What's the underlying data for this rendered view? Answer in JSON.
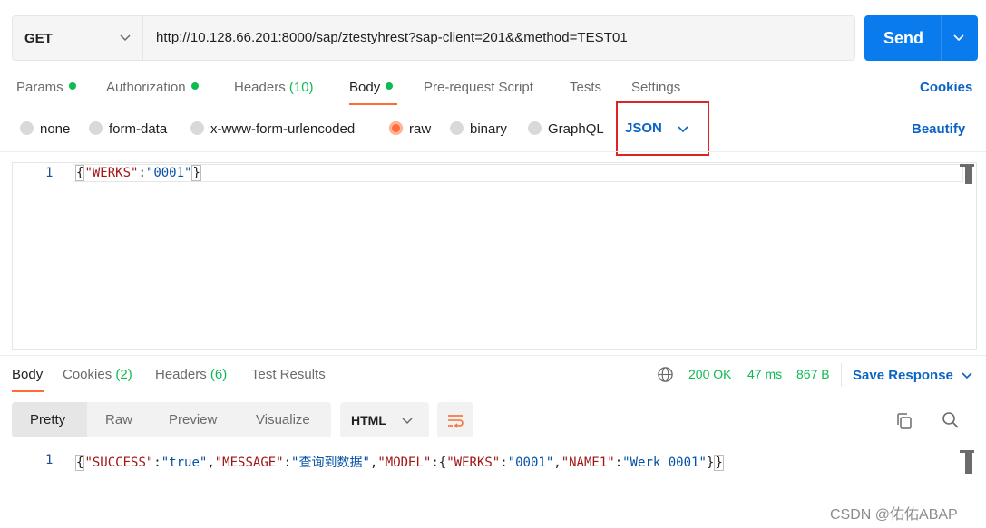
{
  "request": {
    "method": "GET",
    "url": "http://10.128.66.201:8000/sap/ztestyhrest?sap-client=201&&method=TEST01",
    "send_label": "Send"
  },
  "request_tabs": {
    "params": "Params",
    "authorization": "Authorization",
    "headers": "Headers",
    "headers_count": "(10)",
    "body": "Body",
    "pre_request": "Pre-request Script",
    "tests": "Tests",
    "settings": "Settings",
    "cookies": "Cookies"
  },
  "body_types": {
    "none": "none",
    "form_data": "form-data",
    "urlencoded": "x-www-form-urlencoded",
    "raw": "raw",
    "binary": "binary",
    "graphql": "GraphQL",
    "selected_format": "JSON",
    "beautify": "Beautify"
  },
  "request_body": {
    "line_number": "1",
    "open_brace": "{",
    "key": "\"WERKS\"",
    "colon": ":",
    "value": "\"0001\"",
    "close_brace": "}"
  },
  "response_tabs": {
    "body": "Body",
    "cookies": "Cookies",
    "cookies_count": "(2)",
    "headers": "Headers",
    "headers_count": "(6)",
    "test_results": "Test Results"
  },
  "response_status": {
    "status": "200 OK",
    "time": "47 ms",
    "size": "867 B",
    "save_response": "Save Response"
  },
  "response_view": {
    "pretty": "Pretty",
    "raw": "Raw",
    "preview": "Preview",
    "visualize": "Visualize",
    "format": "HTML"
  },
  "response_body": {
    "line_number": "1",
    "open_brace": "{",
    "k1": "\"SUCCESS\"",
    "v1": "\"true\"",
    "k2": "\"MESSAGE\"",
    "v2": "\"查询到数据\"",
    "k3": "\"MODEL\"",
    "inner_open": "{",
    "k4": "\"WERKS\"",
    "v4": "\"0001\"",
    "k5": "\"NAME1\"",
    "v5": "\"Werk 0001\"",
    "inner_close": "}",
    "close_brace": "}"
  },
  "watermark": "CSDN @佑佑ABAP",
  "colors": {
    "accent_orange": "#ff6c37",
    "send_blue": "#097bed",
    "link_blue": "#0b64c5",
    "status_green": "#0cbb52",
    "highlight_red": "#e02424"
  },
  "icons": [
    "chevron-down-icon",
    "globe-icon",
    "wrap-lines-icon",
    "copy-icon",
    "search-icon"
  ]
}
